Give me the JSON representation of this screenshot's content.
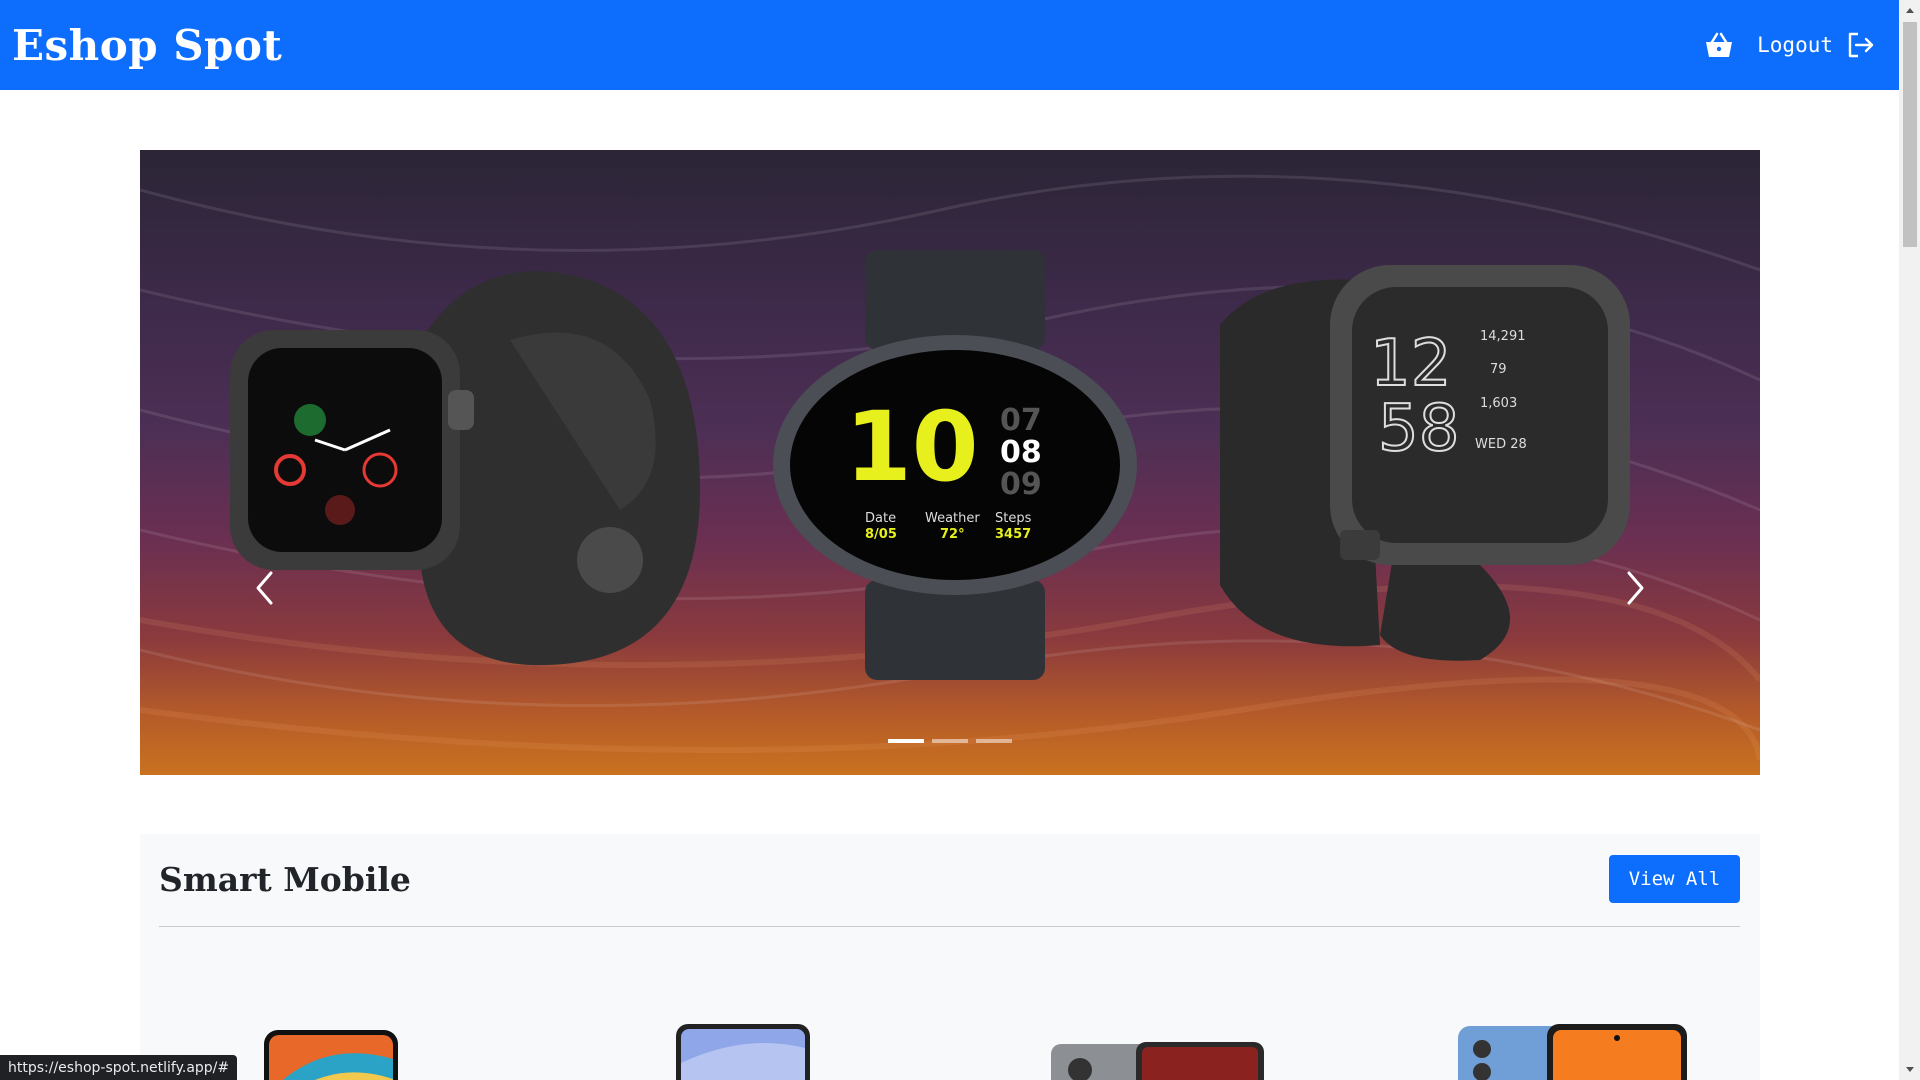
{
  "navbar": {
    "brand": "Eshop Spot",
    "cart_icon": "basket-icon",
    "logout_label": "Logout",
    "logout_icon": "logout-icon",
    "bg_color": "#0d6efd"
  },
  "carousel": {
    "slides": 3,
    "active_slide": 1,
    "prev_icon": "chevron-left-icon",
    "next_icon": "chevron-right-icon",
    "watch_center": {
      "hour": "10",
      "minutes": [
        "07",
        "08",
        "09"
      ],
      "date_label": "Date",
      "date_value": "8/05",
      "weather_label": "Weather",
      "weather_value": "72°",
      "steps_label": "Steps",
      "steps_value": "3457"
    },
    "watch_right": {
      "time_hours": "12",
      "time_minutes": "58",
      "stat1": "14,291",
      "stat2": "79",
      "stat3": "1,603",
      "day": "WED 28"
    }
  },
  "section": {
    "title": "Smart Mobile",
    "view_all_label": "View All"
  },
  "status_bar": {
    "url": "https://eshop-spot.netlify.app/#"
  }
}
